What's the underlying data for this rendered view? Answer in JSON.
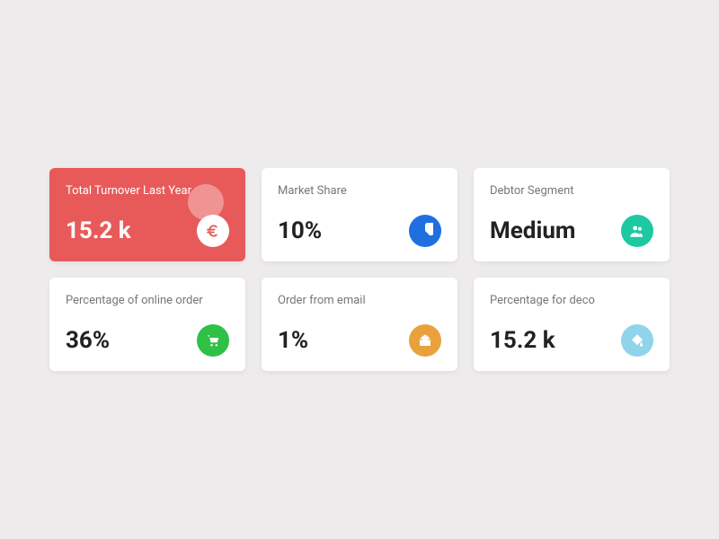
{
  "cards": [
    {
      "label": "Total Turnover Last Year",
      "value": "15.2 k",
      "highlight": true,
      "badge_bg": "#ffffff",
      "icon_color": "#e85a5a",
      "icon": "euro"
    },
    {
      "label": "Market Share",
      "value": "10%",
      "badge_bg": "#1f6fe0",
      "icon_color": "#ffffff",
      "icon": "pie"
    },
    {
      "label": "Debtor Segment",
      "value": "Medium",
      "badge_bg": "#1dc9a0",
      "icon_color": "#ffffff",
      "icon": "users"
    },
    {
      "label": "Percentage of online order",
      "value": "36%",
      "badge_bg": "#2ec145",
      "icon_color": "#ffffff",
      "icon": "cart"
    },
    {
      "label": "Order from email",
      "value": "1%",
      "badge_bg": "#e9a13c",
      "icon_color": "#ffffff",
      "icon": "envelope"
    },
    {
      "label": "Percentage for deco",
      "value": "15.2 k",
      "badge_bg": "#8fd4ea",
      "icon_color": "#ffffff",
      "icon": "bucket"
    }
  ]
}
